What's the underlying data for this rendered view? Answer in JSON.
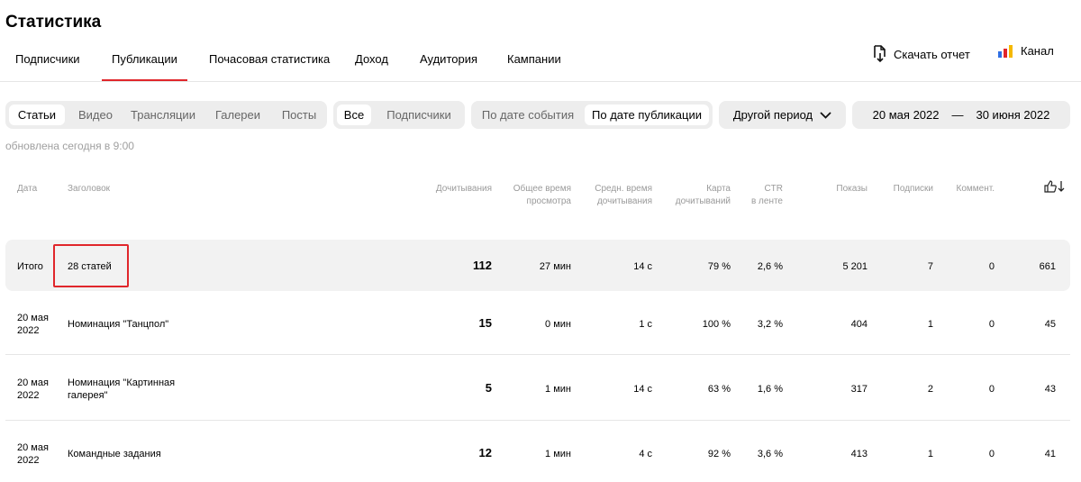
{
  "page_title": "Статистика",
  "nav_tabs": [
    {
      "label": "Подписчики"
    },
    {
      "label": "Публикации",
      "active": true
    },
    {
      "label": "Почасовая статистика"
    },
    {
      "label": "Доход"
    },
    {
      "label": "Аудитория"
    },
    {
      "label": "Кампании"
    }
  ],
  "download_report": "Скачать отчет",
  "channel": "Канал",
  "content_types": [
    "Статьи",
    "Видео",
    "Трансляции",
    "Галереи",
    "Посты"
  ],
  "audience_filter": [
    "Все",
    "Подписчики"
  ],
  "date_mode": [
    "По дате события",
    "По дате публикации"
  ],
  "period_dropdown": "Другой период",
  "date_range": {
    "from": "20 мая 2022",
    "sep": "—",
    "to": "30 июня 2022"
  },
  "updated_text": "обновлена сегодня в 9:00",
  "table": {
    "headers": {
      "date": "Дата",
      "title": "Заголовок",
      "reads": "Дочитывания",
      "total_time": [
        "Общее время",
        "просмотра"
      ],
      "avg_time": [
        "Средн. время",
        "дочитывания"
      ],
      "read_map": [
        "Карта",
        "дочитываний"
      ],
      "ctr": [
        "CTR",
        "в ленте"
      ],
      "impressions": "Показы",
      "subscriptions": "Подписки",
      "comments": "Коммент."
    },
    "total": {
      "label": "Итого",
      "title": "28 статей",
      "reads": "112",
      "total_time": "27 мин",
      "avg_time": "14 с",
      "read_map": "79 %",
      "ctr": "2,6 %",
      "impressions": "5 201",
      "subscriptions": "7",
      "comments": "0",
      "likes": "661"
    },
    "rows": [
      {
        "date": [
          "20 мая",
          "2022"
        ],
        "title": [
          "Номинация \"Танцпол\""
        ],
        "reads": "15",
        "total_time": "0 мин",
        "avg_time": "1 с",
        "read_map": "100 %",
        "ctr": "3,2 %",
        "impressions": "404",
        "subscriptions": "1",
        "comments": "0",
        "likes": "45"
      },
      {
        "date": [
          "20 мая",
          "2022"
        ],
        "title": [
          "Номинация \"Картинная",
          "галерея\""
        ],
        "reads": "5",
        "total_time": "1 мин",
        "avg_time": "14 с",
        "read_map": "63 %",
        "ctr": "1,6 %",
        "impressions": "317",
        "subscriptions": "2",
        "comments": "0",
        "likes": "43"
      },
      {
        "date": [
          "20 мая",
          "2022"
        ],
        "title": [
          "Командные задания"
        ],
        "reads": "12",
        "total_time": "1 мин",
        "avg_time": "4 с",
        "read_map": "92 %",
        "ctr": "3,6 %",
        "impressions": "413",
        "subscriptions": "1",
        "comments": "0",
        "likes": "41"
      }
    ]
  },
  "colors": {
    "accent": "#e0262b",
    "segment_bg": "#ededed",
    "row_bg": "#f2f2f2",
    "muted": "#9a9a9a"
  },
  "icons": {
    "download": "download-file-icon",
    "channel": "bar-chart-logo-icon",
    "likes": "thumbs-up-sort-icon",
    "dropdown": "chevron-down-icon"
  }
}
